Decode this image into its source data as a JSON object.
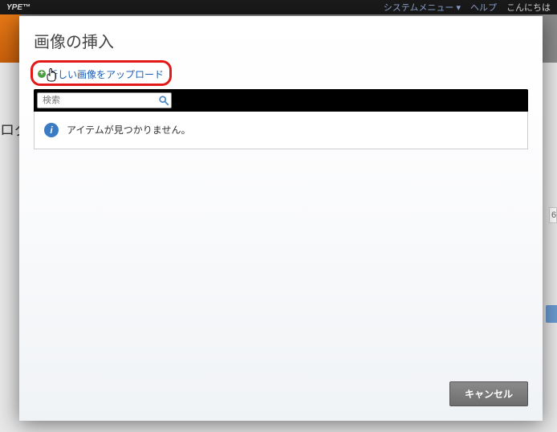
{
  "background": {
    "brand_suffix": "YPE™",
    "system_menu": "システムメニュー ▾",
    "help": "ヘルプ",
    "greeting": "こんにちは",
    "side_text": "ログ",
    "cell_value": "6"
  },
  "modal": {
    "title": "画像の挿入",
    "upload_link": "新しい画像をアップロード",
    "search_placeholder": "検索",
    "empty_message": "アイテムが見つかりません。",
    "cancel_label": "キャンセル"
  }
}
